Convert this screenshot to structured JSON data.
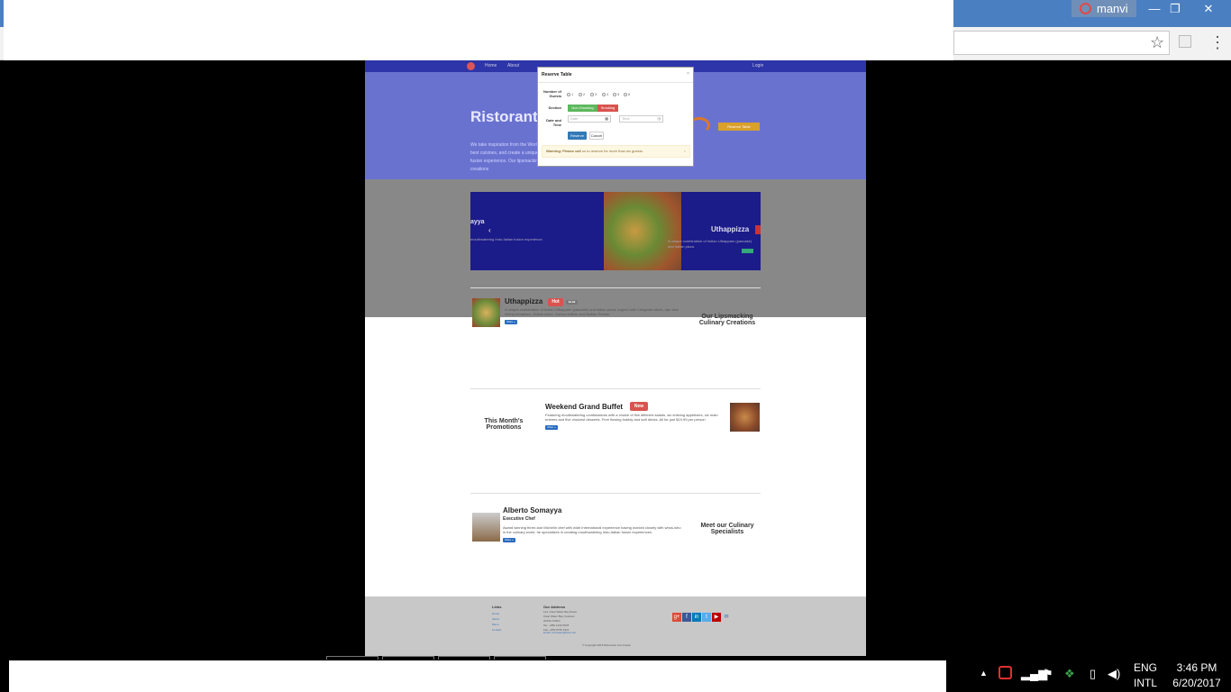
{
  "window": {
    "user_name": "manvi",
    "minimize": "—",
    "restore": "❐",
    "close": "✕"
  },
  "browser": {
    "star_icon": "☆",
    "menu_icon": "⋮"
  },
  "site": {
    "nav": {
      "home": "Home",
      "about": "About",
      "login": "Login"
    },
    "hero": {
      "title": "Ristorant",
      "text": "We take inspiration from the World's best cuisines, and create a unique fusion experience. Our lipsmacking creations",
      "reserve_button": "Reserve Table"
    },
    "carousel": {
      "left_title": "ayya",
      "left_text": "mouthwatering Indo-Italian fusion experience.",
      "right_title": "Uthappizza",
      "right_text": "A unique combination of Indian Uthappam (pancake) and Italian pizza.",
      "prev": "‹"
    },
    "dish": {
      "title": "Uthappizza",
      "badge": "Hot",
      "badge2": "$4.99",
      "description": "A unique combination of Indian Uthappam (pancake) and Italian pizza, topped with Cerignola olives, ripe vine cherry tomatoes, Vidalia onion, Guntur chillies and Buffalo Paneer.",
      "more": "More »",
      "side_title": "Our Lipsmacking Culinary Creations"
    },
    "promotion": {
      "title": "Weekend Grand Buffet",
      "badge": "New",
      "description": "Featuring mouthwatering combinations with a choice of five different salads, six enticing appetizers, six main entrees and five choicest desserts. Free flowing bubbly and soft drinks. All for just $19.99 per person",
      "more": "More »",
      "side_title": "This Month's Promotions"
    },
    "leader": {
      "name": "Alberto Somayya",
      "role": "Executive Chef",
      "description": "Award winning three-star Michelin chef with wide International experience having worked closely with whos-who in the culinary world, he specializes in creating mouthwatering Indo-Italian fusion experiences.",
      "more": "More »",
      "side_title": "Meet our Culinary Specialists"
    },
    "footer": {
      "links_heading": "Links",
      "links": [
        "Home",
        "About",
        "Menu",
        "Contact"
      ],
      "address_heading": "Our Address",
      "address": [
        "121, Clear Water Bay Road",
        "Clear Water Bay, Kowloon",
        "HONG KONG",
        "Tel.: +852 1234 5678",
        "Fax: +852 8765 4321",
        "Email: confusion@food.net"
      ],
      "copyright": "© Copyright 2015 Ristorante Con Fusion",
      "social": [
        "g+",
        "f",
        "in",
        "t",
        "▶",
        "✉"
      ]
    }
  },
  "modal": {
    "title": "Reserve Table",
    "close": "×",
    "guests_label": "Number of Guests",
    "guest_options": [
      "1",
      "2",
      "3",
      "4",
      "5",
      "6"
    ],
    "section_label": "Section",
    "non_smoking": "Non-Smoking",
    "smoking": "Smoking",
    "datetime_label": "Date and Time",
    "date_placeholder": "Date",
    "time_placeholder": "Time",
    "reserve_button": "Reserve",
    "cancel_button": "Cancel",
    "warning_bold": "Warning: Please call",
    "warning_text": " us to reserve for more than six guests."
  },
  "taskbar": {
    "lang_top": "ENG",
    "lang_bottom": "INTL",
    "time": "3:46 PM",
    "date": "6/20/2017"
  },
  "colors": {
    "titlebar": "#4a7fc1",
    "nav": "#2d35a8",
    "hero": "#6a72d0",
    "hot_badge": "#d9534f",
    "success": "#5cb85c",
    "primary": "#2a6bc0"
  }
}
